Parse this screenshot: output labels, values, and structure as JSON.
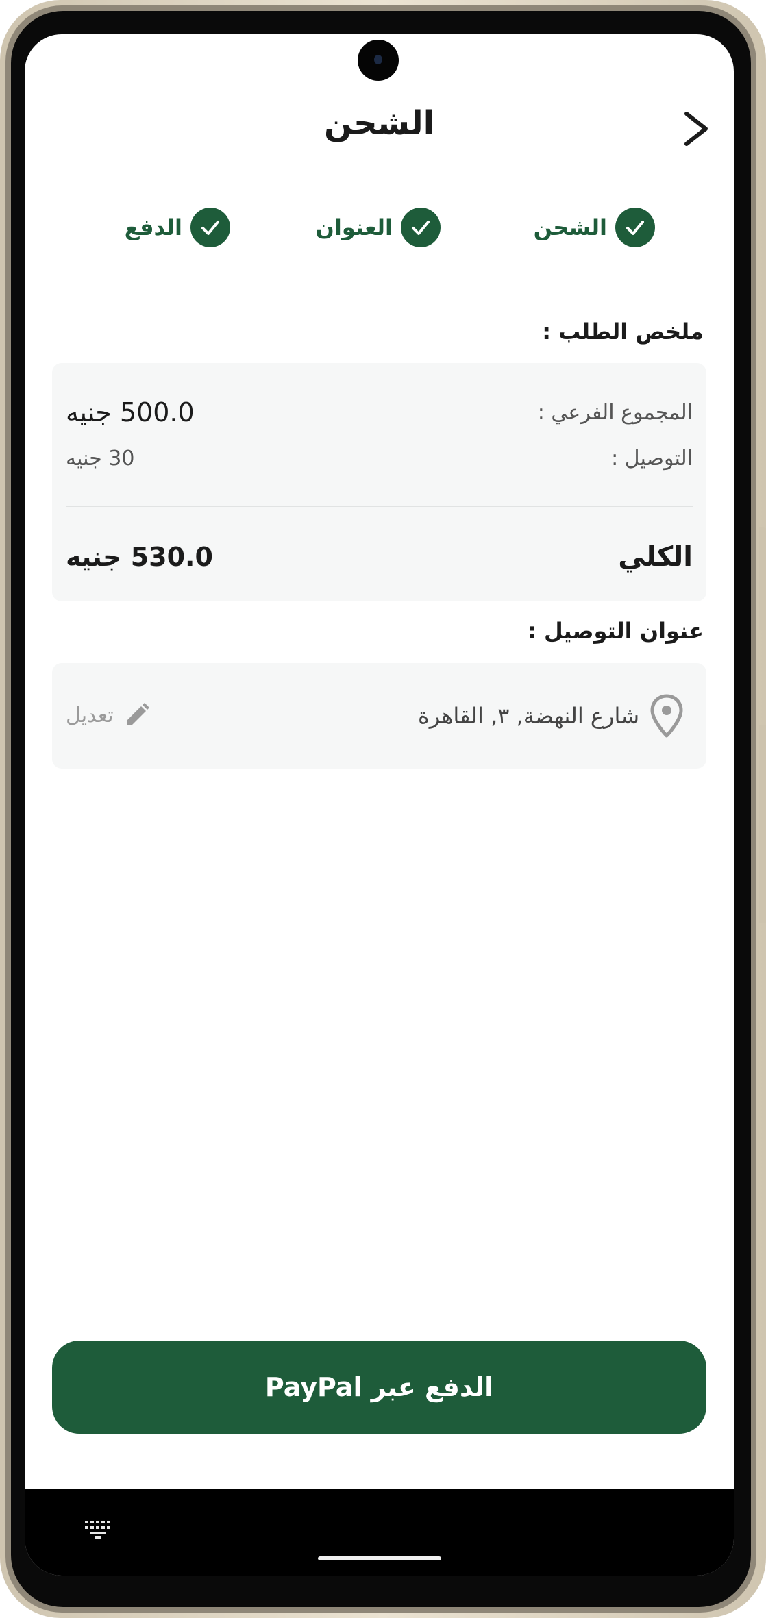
{
  "header": {
    "title": "الشحن"
  },
  "stepper": {
    "steps": [
      {
        "label": "الشحن"
      },
      {
        "label": "العنوان"
      },
      {
        "label": "الدفع"
      }
    ]
  },
  "order_summary": {
    "title": "ملخص الطلب :",
    "subtotal_label": "المجموع الفرعي :",
    "subtotal_value": "500.0 جنيه",
    "delivery_label": "التوصيل :",
    "delivery_value": "30 جنيه",
    "total_label": "الكلي",
    "total_value": "530.0 جنيه"
  },
  "delivery_address": {
    "title": "عنوان التوصيل :",
    "address": "شارع النهضة, ٣, القاهرة",
    "edit_label": "تعديل"
  },
  "pay_button": {
    "label": "الدفع عبر PayPal"
  },
  "colors": {
    "accent": "#1e5c3a",
    "card_background": "#f6f7f7"
  },
  "icons": {
    "back": "chevron-right-icon",
    "step_check": "check-icon",
    "address": "location-pin-icon",
    "edit": "pencil-icon",
    "keyboard": "keyboard-icon"
  }
}
